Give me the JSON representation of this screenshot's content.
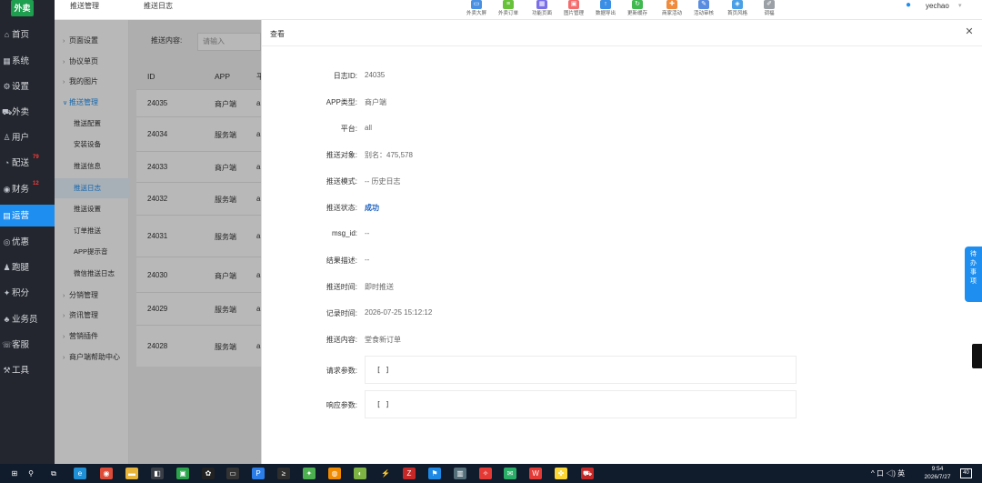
{
  "app": {
    "logo": "外卖"
  },
  "sidebar": {
    "items": [
      {
        "label": "首页",
        "icon": "home-icon",
        "glyph": "⌂"
      },
      {
        "label": "系统",
        "icon": "system-icon",
        "glyph": "▦"
      },
      {
        "label": "设置",
        "icon": "gear-icon",
        "glyph": "⚙"
      },
      {
        "label": "外卖",
        "icon": "cart-icon",
        "glyph": "⛟"
      },
      {
        "label": "用户",
        "icon": "user-icon",
        "glyph": "♙"
      },
      {
        "label": "配送",
        "icon": "delivery-icon",
        "glyph": "◔",
        "badge": "79"
      },
      {
        "label": "财务",
        "icon": "finance-icon",
        "glyph": "◉",
        "badge": "12"
      },
      {
        "label": "运营",
        "icon": "operation-icon",
        "glyph": "▤",
        "active": true
      },
      {
        "label": "优惠",
        "icon": "discount-icon",
        "glyph": "◎"
      },
      {
        "label": "跑腿",
        "icon": "runner-icon",
        "glyph": "♟"
      },
      {
        "label": "积分",
        "icon": "points-icon",
        "glyph": "✦"
      },
      {
        "label": "业务员",
        "icon": "salesman-icon",
        "glyph": "♣"
      },
      {
        "label": "客服",
        "icon": "service-icon",
        "glyph": "☏"
      },
      {
        "label": "工具",
        "icon": "tools-icon",
        "glyph": "⚒"
      }
    ]
  },
  "header": {
    "breadcrumb1": "推送管理",
    "breadcrumb2": "推送日志",
    "tools": [
      {
        "label": "外卖大屏",
        "icon": "screen-icon",
        "color": "#4a90e2",
        "glyph": "▭"
      },
      {
        "label": "外卖订单",
        "icon": "order-icon",
        "color": "#67c23a",
        "glyph": "≡"
      },
      {
        "label": "功能页面",
        "icon": "pages-icon",
        "color": "#7b6fe8",
        "glyph": "▦"
      },
      {
        "label": "图片管理",
        "icon": "image-icon",
        "color": "#f56c6c",
        "glyph": "▣"
      },
      {
        "label": "数据导出",
        "icon": "export-icon",
        "color": "#3a8ee6",
        "glyph": "↑"
      },
      {
        "label": "更新缓存",
        "icon": "refresh-icon",
        "color": "#3fb950",
        "glyph": "↻"
      },
      {
        "label": "商家活动",
        "icon": "gift-icon",
        "color": "#f08a3c",
        "glyph": "✚"
      },
      {
        "label": "活动审核",
        "icon": "audit-icon",
        "color": "#5a8de0",
        "glyph": "✎"
      },
      {
        "label": "首页风格",
        "icon": "style-icon",
        "color": "#4aa0e6",
        "glyph": "◈"
      },
      {
        "label": "调福",
        "icon": "edit-icon",
        "color": "#9aa0a6",
        "glyph": "✐"
      }
    ],
    "user": "yechao"
  },
  "submenu": {
    "items": [
      {
        "label": "页面设置"
      },
      {
        "label": "协议单页"
      },
      {
        "label": "我的图片"
      },
      {
        "label": "推送管理",
        "open": true,
        "children": [
          {
            "label": "推送配置"
          },
          {
            "label": "安装设备"
          },
          {
            "label": "推送信息"
          },
          {
            "label": "推送日志",
            "active": true
          },
          {
            "label": "推送设置"
          },
          {
            "label": "订单推送"
          },
          {
            "label": "APP提示音"
          },
          {
            "label": "微信推送日志"
          }
        ]
      },
      {
        "label": "分销管理"
      },
      {
        "label": "资讯管理"
      },
      {
        "label": "营销插件"
      },
      {
        "label": "商户端帮助中心"
      }
    ]
  },
  "list": {
    "search_label": "推送内容:",
    "search_placeholder": "请输入",
    "columns": [
      "ID",
      "APP",
      "平"
    ],
    "rows": [
      {
        "id": "24035",
        "app": "商户端",
        "p": "a"
      },
      {
        "id": "24034",
        "app": "服务端",
        "p": "a"
      },
      {
        "id": "24033",
        "app": "商户端",
        "p": "a"
      },
      {
        "id": "24032",
        "app": "服务端",
        "p": "a"
      },
      {
        "id": "24031",
        "app": "服务端",
        "p": "a"
      },
      {
        "id": "24030",
        "app": "商户端",
        "p": "a"
      },
      {
        "id": "24029",
        "app": "服务端",
        "p": "a"
      },
      {
        "id": "24028",
        "app": "服务端",
        "p": "a"
      }
    ]
  },
  "detail": {
    "title": "查看",
    "fields": [
      {
        "label": "日志ID:",
        "value": "24035"
      },
      {
        "label": "APP类型:",
        "value": "商户端"
      },
      {
        "label": "平台:",
        "value": "all"
      },
      {
        "label": "推送对象:",
        "value": "别名：475,578"
      },
      {
        "label": "推送模式:",
        "value": "-- 历史日志"
      },
      {
        "label": "推送状态:",
        "value": "成功",
        "status": true
      },
      {
        "label": "msg_id:",
        "value": "--"
      },
      {
        "label": "结果描述:",
        "value": "--"
      },
      {
        "label": "推送时间:",
        "value": "即时推送"
      },
      {
        "label": "记录时间:",
        "value": "2026-07-25 15:12:12"
      },
      {
        "label": "推送内容:",
        "value": "堂食新订单"
      }
    ],
    "request_label": "请求参数:",
    "request_value": "[ ]",
    "response_label": "响应参数:",
    "response_value": "[ ]"
  },
  "float_tab": {
    "label": "待办事项"
  },
  "taskbar": {
    "apps": [
      {
        "icon": "start-icon",
        "glyph": "⊞",
        "color": "#101b2c"
      },
      {
        "icon": "search-icon",
        "glyph": "⚲",
        "color": "#101b2c"
      },
      {
        "icon": "taskview-icon",
        "glyph": "⧉",
        "color": "#101b2c"
      },
      {
        "icon": "edge-icon",
        "glyph": "e",
        "color": "#1f8fd6"
      },
      {
        "icon": "chrome-icon",
        "glyph": "◉",
        "color": "#dd4b39"
      },
      {
        "icon": "explorer-icon",
        "glyph": "▬",
        "color": "#e8b53a"
      },
      {
        "icon": "app1-icon",
        "glyph": "◧",
        "color": "#3a3f47"
      },
      {
        "icon": "terminal-icon",
        "glyph": "▣",
        "color": "#2aa34a"
      },
      {
        "icon": "chatgpt-icon",
        "glyph": "✿",
        "color": "#222222"
      },
      {
        "icon": "cmd-icon",
        "glyph": "▭",
        "color": "#333333"
      },
      {
        "icon": "p-icon",
        "glyph": "P",
        "color": "#2b7de9"
      },
      {
        "icon": "shell-icon",
        "glyph": "≥",
        "color": "#2d2d2d"
      },
      {
        "icon": "frog-icon",
        "glyph": "✦",
        "color": "#4caf50"
      },
      {
        "icon": "orange-icon",
        "glyph": "◍",
        "color": "#f08a00"
      },
      {
        "icon": "green-icon",
        "glyph": "◐",
        "color": "#7cb342"
      },
      {
        "icon": "bolt-icon",
        "glyph": "⚡",
        "color": "#101b2c"
      },
      {
        "icon": "filezilla-icon",
        "glyph": "Z",
        "color": "#c62828"
      },
      {
        "icon": "bookmark-icon",
        "glyph": "⚑",
        "color": "#1e88e5"
      },
      {
        "icon": "doc-icon",
        "glyph": "▥",
        "color": "#546e7a"
      },
      {
        "icon": "bird-icon",
        "glyph": "✧",
        "color": "#e53935"
      },
      {
        "icon": "wechat-icon",
        "glyph": "✉",
        "color": "#2aae67"
      },
      {
        "icon": "wps-icon",
        "glyph": "W",
        "color": "#e53935"
      },
      {
        "icon": "paw-icon",
        "glyph": "✤",
        "color": "#fdd835"
      },
      {
        "icon": "car-icon",
        "glyph": "⛟",
        "color": "#c62828"
      }
    ],
    "tray": "^ 口 ◁) 英",
    "time": "9:54",
    "date": "2026/7/27",
    "notif": "40"
  }
}
